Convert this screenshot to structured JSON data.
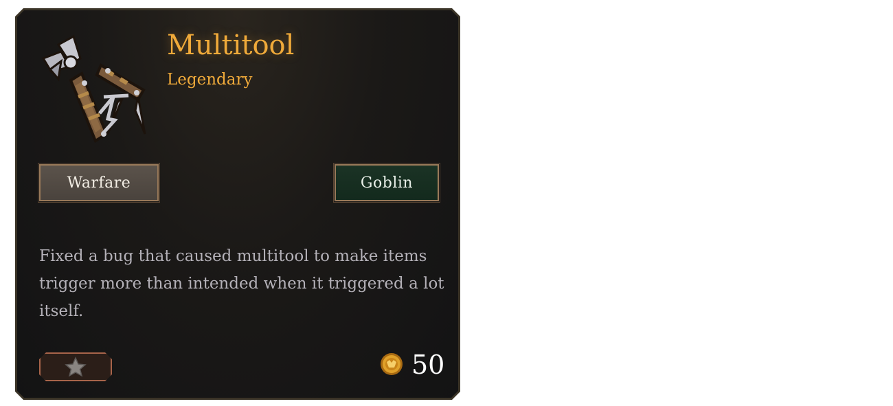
{
  "item": {
    "name": "Multitool",
    "rarity": "Legendary",
    "icon": "multitool-icon",
    "tags": {
      "warfare": "Warfare",
      "goblin": "Goblin"
    },
    "description": "Fixed a bug that caused multitool to make items trigger more than intended when it triggered a lot itself.",
    "price": "50",
    "currency_icon": "gold-coin-icon",
    "favorite_icon": "star-icon"
  },
  "colors": {
    "rarity_accent": "#f0aa3a",
    "warfare_tag_bg": "#514a43",
    "goblin_tag_bg": "#173022",
    "card_bg": "#161516"
  }
}
